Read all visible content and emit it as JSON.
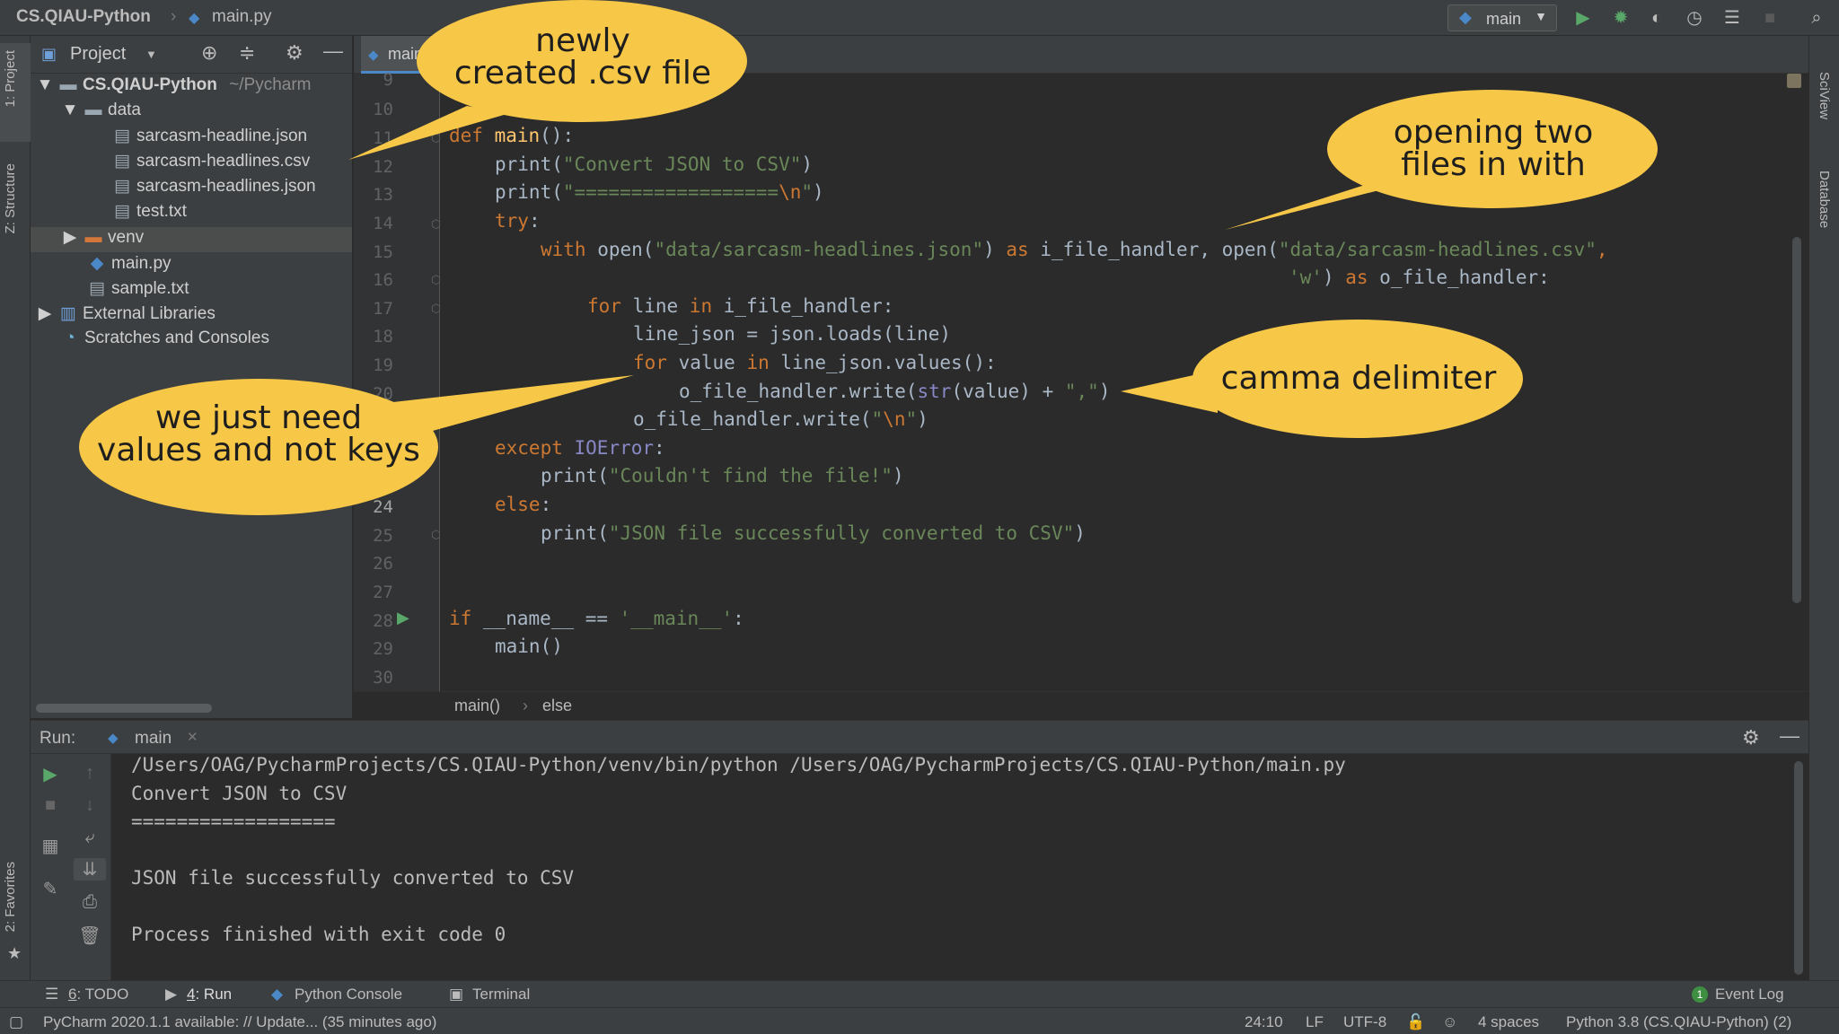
{
  "nav": {
    "project": "CS.QIAU-Python",
    "file": "main.py"
  },
  "toolbar": {
    "run_config": "main"
  },
  "stripes": {
    "project": "1: Project",
    "structure": "Z: Structure",
    "favorites": "2: Favorites",
    "sciview": "SciView",
    "database": "Database"
  },
  "project_panel": {
    "title": "Project",
    "root": "CS.QIAU-Python",
    "root_path": "~/Pycharm",
    "items": [
      {
        "label": "data"
      },
      {
        "label": "sarcasm-headline.json"
      },
      {
        "label": "sarcasm-headlines.csv"
      },
      {
        "label": "sarcasm-headlines.json"
      },
      {
        "label": "test.txt"
      },
      {
        "label": "venv"
      },
      {
        "label": "main.py"
      },
      {
        "label": "sample.txt"
      },
      {
        "label": "External Libraries"
      },
      {
        "label": "Scratches and Consoles"
      }
    ]
  },
  "editor": {
    "tab": "main.py",
    "line_numbers": [
      "9",
      "10",
      "11",
      "12",
      "13",
      "14",
      "15",
      "16",
      "17",
      "18",
      "19",
      "20",
      "",
      "24",
      "25",
      "26",
      "27",
      "28",
      "29",
      "30"
    ],
    "breadcrumb": [
      "main()",
      "else"
    ],
    "code": {
      "l11_kw": "def ",
      "l11_fn": "main",
      "l11_rest": "():",
      "l12_a": "print(",
      "l12_s": "\"Convert JSON to CSV\"",
      "l12_b": ")",
      "l13_a": "print(",
      "l13_s": "\"==================",
      "l13_e": "\\n",
      "l13_s2": "\"",
      "l13_b": ")",
      "l14_kw": "try",
      "l14_b": ":",
      "l15_kw": "with ",
      "l15_a": "open(",
      "l15_s": "\"data/sarcasm-headlines.json\"",
      "l15_b": ") ",
      "l15_kw2": "as",
      "l15_c": " i_file_handler, ",
      "l15_d": "open(",
      "l15_s2": "\"data/sarcasm-headlines.csv\"",
      "l15_e": ",",
      "l16_s": "'w'",
      "l16_b": ") ",
      "l16_kw": "as",
      "l16_c": " o_file_handler:",
      "l17_kw": "for",
      "l17_a": " line ",
      "l17_kw2": "in",
      "l17_b": " i_file_handler:",
      "l18": "line_json = json.loads(line)",
      "l19_kw": "for",
      "l19_a": " value ",
      "l19_kw2": "in",
      "l19_b": " line_json.values():",
      "l20_a": "o_file_handler.write(",
      "l20_bi": "str",
      "l20_b": "(value) + ",
      "l20_s": "\",\"",
      "l20_c": ")",
      "l21_a": "o_file_handler.write(",
      "l21_s": "\"",
      "l21_e": "\\n",
      "l21_s2": "\"",
      "l21_b": ")",
      "l22_kw": "except ",
      "l22_bi": "IOError",
      "l22_b": ":",
      "l23_a": "print(",
      "l23_s": "\"Couldn't find the file!\"",
      "l23_b": ")",
      "l24_kw": "else",
      "l24_b": ":",
      "l25_a": "print(",
      "l25_s": "\"JSON file successfully converted to CSV\"",
      "l25_b": ")",
      "l28_kw": "if ",
      "l28_a": "__name__ == ",
      "l28_s": "'__main__'",
      "l28_b": ":",
      "l29": "main()"
    }
  },
  "run": {
    "label": "Run:",
    "tab": "main",
    "output": [
      "/Users/OAG/PycharmProjects/CS.QIAU-Python/venv/bin/python /Users/OAG/PycharmProjects/CS.QIAU-Python/main.py",
      "Convert JSON to CSV",
      "==================",
      "",
      "JSON file successfully converted to CSV",
      "",
      "Process finished with exit code 0"
    ]
  },
  "bottom_tabs": {
    "todo_num": "6",
    "todo": ": TODO",
    "run_num": "4",
    "run": ": Run",
    "python_console": "Python Console",
    "terminal": "Terminal",
    "event_log_count": "1",
    "event_log": "Event Log"
  },
  "status": {
    "message": "PyCharm 2020.1.1 available: // Update... (35 minutes ago)",
    "position": "24:10",
    "line_sep": "LF",
    "encoding": "UTF-8",
    "indent": "4 spaces",
    "interpreter": "Python 3.8 (CS.QIAU-Python) (2)"
  },
  "annotations": {
    "csv_file": [
      "newly",
      "created .csv file"
    ],
    "open_two": [
      "opening two",
      "files in with"
    ],
    "delimiter": [
      "camma delimiter"
    ],
    "values": [
      "we just need",
      "values and not keys"
    ],
    "fill": "#f7c748"
  }
}
